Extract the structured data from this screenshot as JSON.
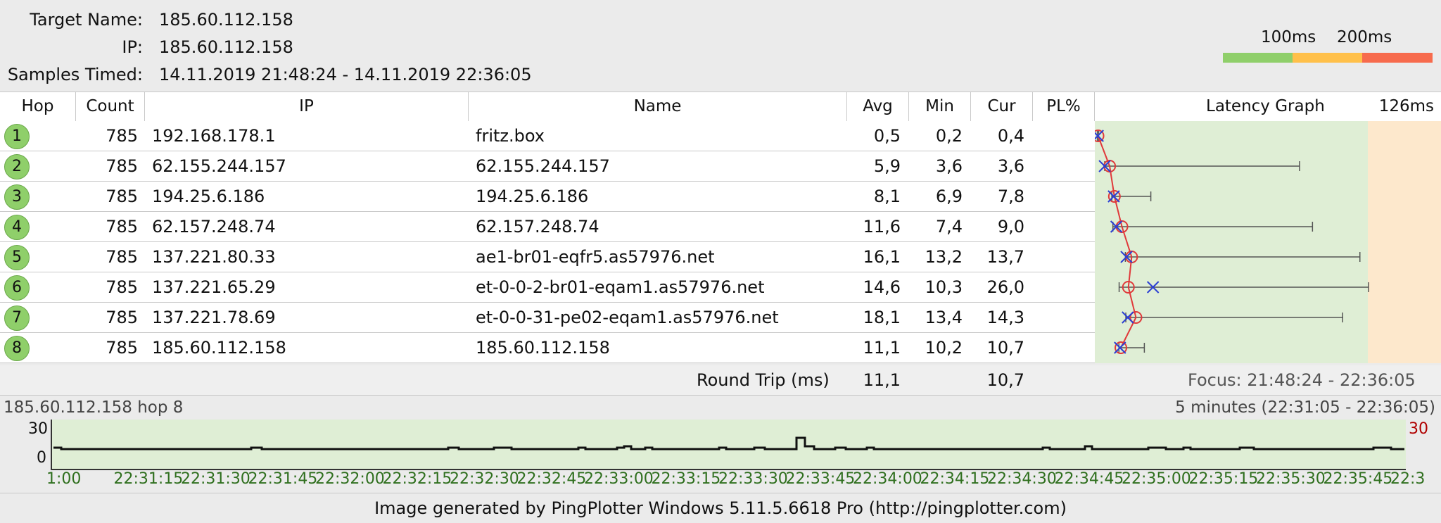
{
  "info": {
    "target_label": "Target Name:",
    "target_value": "185.60.112.158",
    "ip_label": "IP:",
    "ip_value": "185.60.112.158",
    "samples_label": "Samples Timed:",
    "samples_value": "14.11.2019 21:48:24 - 14.11.2019 22:36:05"
  },
  "legend": {
    "label_100": "100ms",
    "label_200": "200ms",
    "colors": {
      "good": "#8fcf6a",
      "warn": "#ffc04a",
      "bad": "#f76b4d"
    }
  },
  "table": {
    "headers": {
      "hop": "Hop",
      "count": "Count",
      "ip": "IP",
      "name": "Name",
      "avg": "Avg",
      "min": "Min",
      "cur": "Cur",
      "pl": "PL%",
      "graph": "Latency Graph",
      "scale": "126ms"
    },
    "rows": [
      {
        "hop": "1",
        "count": "785",
        "ip": "192.168.178.1",
        "name": "fritz.box",
        "avg": "0,5",
        "min": "0,2",
        "cur": "0,4",
        "pl": ""
      },
      {
        "hop": "2",
        "count": "785",
        "ip": "62.155.244.157",
        "name": "62.155.244.157",
        "avg": "5,9",
        "min": "3,6",
        "cur": "3,6",
        "pl": ""
      },
      {
        "hop": "3",
        "count": "785",
        "ip": "194.25.6.186",
        "name": "194.25.6.186",
        "avg": "8,1",
        "min": "6,9",
        "cur": "7,8",
        "pl": ""
      },
      {
        "hop": "4",
        "count": "785",
        "ip": "62.157.248.74",
        "name": "62.157.248.74",
        "avg": "11,6",
        "min": "7,4",
        "cur": "9,0",
        "pl": ""
      },
      {
        "hop": "5",
        "count": "785",
        "ip": "137.221.80.33",
        "name": "ae1-br01-eqfr5.as57976.net",
        "avg": "16,1",
        "min": "13,2",
        "cur": "13,7",
        "pl": ""
      },
      {
        "hop": "6",
        "count": "785",
        "ip": "137.221.65.29",
        "name": "et-0-0-2-br01-eqam1.as57976.net",
        "avg": "14,6",
        "min": "10,3",
        "cur": "26,0",
        "pl": ""
      },
      {
        "hop": "7",
        "count": "785",
        "ip": "137.221.78.69",
        "name": "et-0-0-31-pe02-eqam1.as57976.net",
        "avg": "18,1",
        "min": "13,4",
        "cur": "14,3",
        "pl": ""
      },
      {
        "hop": "8",
        "count": "785",
        "ip": "185.60.112.158",
        "name": "185.60.112.158",
        "avg": "11,1",
        "min": "10,2",
        "cur": "10,7",
        "pl": ""
      }
    ],
    "graph_max_ms": [
      0.8,
      94,
      25,
      100,
      122,
      126,
      114,
      22
    ],
    "footer": {
      "label": "Round Trip (ms)",
      "avg": "11,1",
      "cur": "10,7",
      "focus": "Focus: 21:48:24 - 22:36:05"
    }
  },
  "timeline": {
    "title": "185.60.112.158 hop 8",
    "range": "5 minutes (22:31:05 - 22:36:05)",
    "y_top": "30",
    "y_bottom": "0",
    "y_right": "30",
    "ticks": [
      "1:00",
      "22:31:15",
      "22:31:30",
      "22:31:45",
      "22:32:00",
      "22:32:15",
      "22:32:30",
      "22:32:45",
      "22:33:00",
      "22:33:15",
      "22:33:30",
      "22:33:45",
      "22:34:00",
      "22:34:15",
      "22:34:30",
      "22:34:45",
      "22:35:00",
      "22:35:15",
      "22:35:30",
      "22:35:45",
      "22:3"
    ]
  },
  "footer_text": "Image generated by PingPlotter Windows 5.11.5.6618 Pro (http://pingplotter.com)"
}
